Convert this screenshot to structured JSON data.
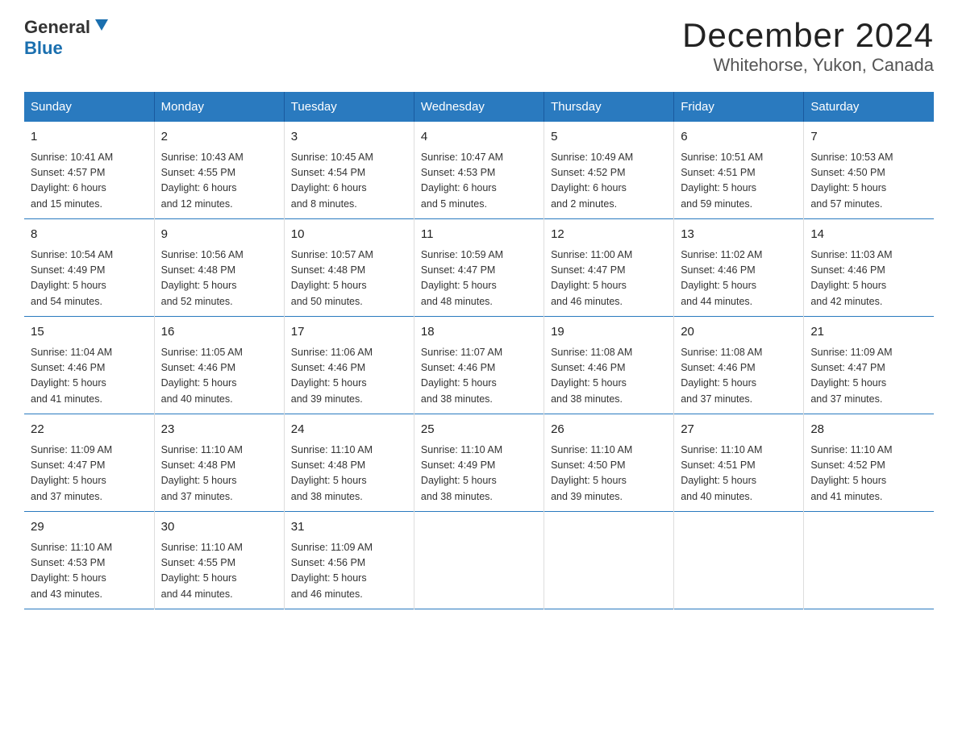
{
  "header": {
    "logo_line1": "General",
    "logo_line2": "Blue",
    "title": "December 2024",
    "subtitle": "Whitehorse, Yukon, Canada"
  },
  "days_of_week": [
    "Sunday",
    "Monday",
    "Tuesday",
    "Wednesday",
    "Thursday",
    "Friday",
    "Saturday"
  ],
  "weeks": [
    [
      {
        "num": "1",
        "info": "Sunrise: 10:41 AM\nSunset: 4:57 PM\nDaylight: 6 hours\nand 15 minutes."
      },
      {
        "num": "2",
        "info": "Sunrise: 10:43 AM\nSunset: 4:55 PM\nDaylight: 6 hours\nand 12 minutes."
      },
      {
        "num": "3",
        "info": "Sunrise: 10:45 AM\nSunset: 4:54 PM\nDaylight: 6 hours\nand 8 minutes."
      },
      {
        "num": "4",
        "info": "Sunrise: 10:47 AM\nSunset: 4:53 PM\nDaylight: 6 hours\nand 5 minutes."
      },
      {
        "num": "5",
        "info": "Sunrise: 10:49 AM\nSunset: 4:52 PM\nDaylight: 6 hours\nand 2 minutes."
      },
      {
        "num": "6",
        "info": "Sunrise: 10:51 AM\nSunset: 4:51 PM\nDaylight: 5 hours\nand 59 minutes."
      },
      {
        "num": "7",
        "info": "Sunrise: 10:53 AM\nSunset: 4:50 PM\nDaylight: 5 hours\nand 57 minutes."
      }
    ],
    [
      {
        "num": "8",
        "info": "Sunrise: 10:54 AM\nSunset: 4:49 PM\nDaylight: 5 hours\nand 54 minutes."
      },
      {
        "num": "9",
        "info": "Sunrise: 10:56 AM\nSunset: 4:48 PM\nDaylight: 5 hours\nand 52 minutes."
      },
      {
        "num": "10",
        "info": "Sunrise: 10:57 AM\nSunset: 4:48 PM\nDaylight: 5 hours\nand 50 minutes."
      },
      {
        "num": "11",
        "info": "Sunrise: 10:59 AM\nSunset: 4:47 PM\nDaylight: 5 hours\nand 48 minutes."
      },
      {
        "num": "12",
        "info": "Sunrise: 11:00 AM\nSunset: 4:47 PM\nDaylight: 5 hours\nand 46 minutes."
      },
      {
        "num": "13",
        "info": "Sunrise: 11:02 AM\nSunset: 4:46 PM\nDaylight: 5 hours\nand 44 minutes."
      },
      {
        "num": "14",
        "info": "Sunrise: 11:03 AM\nSunset: 4:46 PM\nDaylight: 5 hours\nand 42 minutes."
      }
    ],
    [
      {
        "num": "15",
        "info": "Sunrise: 11:04 AM\nSunset: 4:46 PM\nDaylight: 5 hours\nand 41 minutes."
      },
      {
        "num": "16",
        "info": "Sunrise: 11:05 AM\nSunset: 4:46 PM\nDaylight: 5 hours\nand 40 minutes."
      },
      {
        "num": "17",
        "info": "Sunrise: 11:06 AM\nSunset: 4:46 PM\nDaylight: 5 hours\nand 39 minutes."
      },
      {
        "num": "18",
        "info": "Sunrise: 11:07 AM\nSunset: 4:46 PM\nDaylight: 5 hours\nand 38 minutes."
      },
      {
        "num": "19",
        "info": "Sunrise: 11:08 AM\nSunset: 4:46 PM\nDaylight: 5 hours\nand 38 minutes."
      },
      {
        "num": "20",
        "info": "Sunrise: 11:08 AM\nSunset: 4:46 PM\nDaylight: 5 hours\nand 37 minutes."
      },
      {
        "num": "21",
        "info": "Sunrise: 11:09 AM\nSunset: 4:47 PM\nDaylight: 5 hours\nand 37 minutes."
      }
    ],
    [
      {
        "num": "22",
        "info": "Sunrise: 11:09 AM\nSunset: 4:47 PM\nDaylight: 5 hours\nand 37 minutes."
      },
      {
        "num": "23",
        "info": "Sunrise: 11:10 AM\nSunset: 4:48 PM\nDaylight: 5 hours\nand 37 minutes."
      },
      {
        "num": "24",
        "info": "Sunrise: 11:10 AM\nSunset: 4:48 PM\nDaylight: 5 hours\nand 38 minutes."
      },
      {
        "num": "25",
        "info": "Sunrise: 11:10 AM\nSunset: 4:49 PM\nDaylight: 5 hours\nand 38 minutes."
      },
      {
        "num": "26",
        "info": "Sunrise: 11:10 AM\nSunset: 4:50 PM\nDaylight: 5 hours\nand 39 minutes."
      },
      {
        "num": "27",
        "info": "Sunrise: 11:10 AM\nSunset: 4:51 PM\nDaylight: 5 hours\nand 40 minutes."
      },
      {
        "num": "28",
        "info": "Sunrise: 11:10 AM\nSunset: 4:52 PM\nDaylight: 5 hours\nand 41 minutes."
      }
    ],
    [
      {
        "num": "29",
        "info": "Sunrise: 11:10 AM\nSunset: 4:53 PM\nDaylight: 5 hours\nand 43 minutes."
      },
      {
        "num": "30",
        "info": "Sunrise: 11:10 AM\nSunset: 4:55 PM\nDaylight: 5 hours\nand 44 minutes."
      },
      {
        "num": "31",
        "info": "Sunrise: 11:09 AM\nSunset: 4:56 PM\nDaylight: 5 hours\nand 46 minutes."
      },
      {
        "num": "",
        "info": ""
      },
      {
        "num": "",
        "info": ""
      },
      {
        "num": "",
        "info": ""
      },
      {
        "num": "",
        "info": ""
      }
    ]
  ]
}
